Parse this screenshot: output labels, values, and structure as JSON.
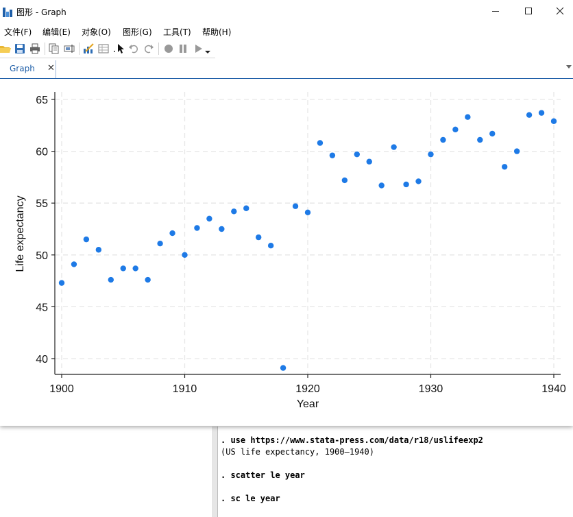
{
  "window": {
    "title": "图形 - Graph",
    "controls": {
      "minimize": "—",
      "maximize": "☐",
      "close": "✕"
    }
  },
  "menu": [
    "文件(F)",
    "编辑(E)",
    "对象(O)",
    "图形(G)",
    "工具(T)",
    "帮助(H)"
  ],
  "toolbar": {
    "icons": [
      "open-icon",
      "save-icon",
      "print-icon",
      "copy-icon",
      "rename-icon",
      "graph-editor-icon",
      "data-editor-icon",
      "pointer-icon",
      "undo-icon",
      "redo-icon",
      "record-icon",
      "pause-icon",
      "play-icon"
    ]
  },
  "tab": {
    "label": "Graph",
    "close": "✕"
  },
  "colors": {
    "marker": "#1e7ae6",
    "accent": "#1f5fa8",
    "grid": "#e6e6e6"
  },
  "chart_data": {
    "type": "scatter",
    "title": "",
    "xlabel": "Year",
    "ylabel": "Life expectancy",
    "xlim": [
      1900,
      1940
    ],
    "ylim": [
      39,
      65
    ],
    "xticks": [
      1900,
      1910,
      1920,
      1930,
      1940
    ],
    "yticks": [
      40,
      45,
      50,
      55,
      60,
      65
    ],
    "grid": true,
    "legend": "none",
    "points": [
      {
        "x": 1900,
        "y": 47.3
      },
      {
        "x": 1901,
        "y": 49.1
      },
      {
        "x": 1902,
        "y": 51.5
      },
      {
        "x": 1903,
        "y": 50.5
      },
      {
        "x": 1904,
        "y": 47.6
      },
      {
        "x": 1905,
        "y": 48.7
      },
      {
        "x": 1906,
        "y": 48.7
      },
      {
        "x": 1907,
        "y": 47.6
      },
      {
        "x": 1908,
        "y": 51.1
      },
      {
        "x": 1909,
        "y": 52.1
      },
      {
        "x": 1910,
        "y": 50.0
      },
      {
        "x": 1911,
        "y": 52.6
      },
      {
        "x": 1912,
        "y": 53.5
      },
      {
        "x": 1913,
        "y": 52.5
      },
      {
        "x": 1914,
        "y": 54.2
      },
      {
        "x": 1915,
        "y": 54.5
      },
      {
        "x": 1916,
        "y": 51.7
      },
      {
        "x": 1917,
        "y": 50.9
      },
      {
        "x": 1918,
        "y": 39.1
      },
      {
        "x": 1919,
        "y": 54.7
      },
      {
        "x": 1920,
        "y": 54.1
      },
      {
        "x": 1921,
        "y": 60.8
      },
      {
        "x": 1922,
        "y": 59.6
      },
      {
        "x": 1923,
        "y": 57.2
      },
      {
        "x": 1924,
        "y": 59.7
      },
      {
        "x": 1925,
        "y": 59.0
      },
      {
        "x": 1926,
        "y": 56.7
      },
      {
        "x": 1927,
        "y": 60.4
      },
      {
        "x": 1928,
        "y": 56.8
      },
      {
        "x": 1929,
        "y": 57.1
      },
      {
        "x": 1930,
        "y": 59.7
      },
      {
        "x": 1931,
        "y": 61.1
      },
      {
        "x": 1932,
        "y": 62.1
      },
      {
        "x": 1933,
        "y": 63.3
      },
      {
        "x": 1934,
        "y": 61.1
      },
      {
        "x": 1935,
        "y": 61.7
      },
      {
        "x": 1936,
        "y": 58.5
      },
      {
        "x": 1937,
        "y": 60.0
      },
      {
        "x": 1938,
        "y": 63.5
      },
      {
        "x": 1939,
        "y": 63.7
      },
      {
        "x": 1940,
        "y": 62.9
      }
    ]
  },
  "console": {
    "lines": [
      {
        "text": ". use https://www.stata-press.com/data/r18/uslifeexp2",
        "kind": "cmd"
      },
      {
        "text": "(US life expectancy, 1900–1940)",
        "kind": "out"
      },
      {
        "text": "",
        "kind": "gap"
      },
      {
        "text": ". scatter le year",
        "kind": "cmd"
      },
      {
        "text": "",
        "kind": "gap"
      },
      {
        "text": ". sc le year",
        "kind": "cmd"
      }
    ]
  }
}
